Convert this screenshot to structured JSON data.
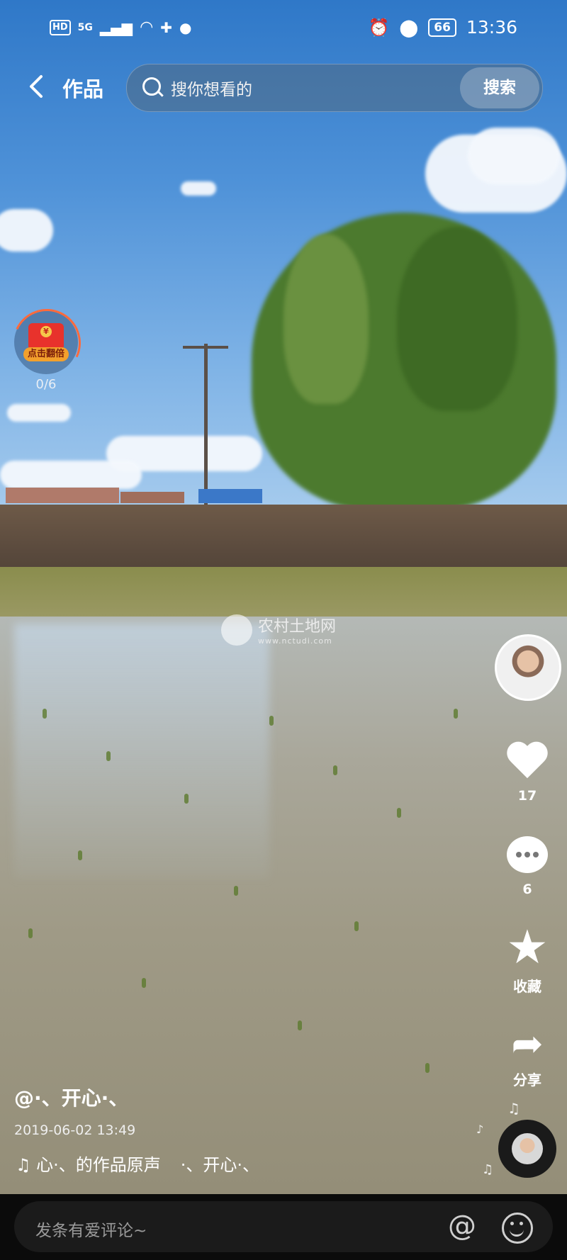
{
  "status_bar": {
    "network_badge": "HD",
    "network_type": "5G",
    "battery": "66",
    "time": "13:36"
  },
  "top_bar": {
    "title": "作品",
    "search_placeholder": "搜你想看的",
    "search_button": "搜索"
  },
  "red_packet": {
    "label": "点击翻倍",
    "coin_symbol": "¥",
    "progress": "0/6"
  },
  "watermark": {
    "name": "农村土地网",
    "url": "www.nctudi.com"
  },
  "actions": {
    "likes": "17",
    "comments": "6",
    "favorite_label": "收藏",
    "share_label": "分享"
  },
  "video": {
    "author": "@·、开心·、",
    "date": "2019-06-02 13:49",
    "music_title": "心·、的作品原声",
    "music_author": "·、开心·、"
  },
  "comment_bar": {
    "placeholder": "发条有爱评论~"
  },
  "icons": [
    "back-arrow-icon",
    "search-icon",
    "heart-icon",
    "comment-icon",
    "star-icon",
    "share-icon",
    "music-note-icon",
    "at-icon",
    "emoji-icon",
    "alarm-icon",
    "location-icon",
    "wifi-icon",
    "signal-icon"
  ]
}
